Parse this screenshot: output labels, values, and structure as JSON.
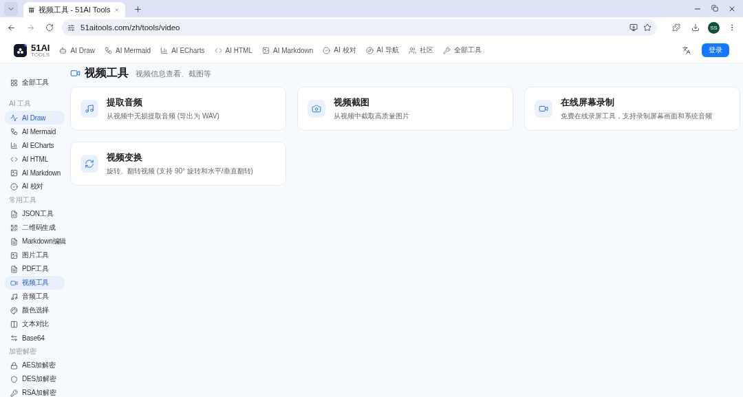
{
  "browser": {
    "tab_title": "视频工具 - 51AI Tools",
    "url": "51aitools.com/zh/tools/video",
    "profile": "SS"
  },
  "header": {
    "logo": "51AI",
    "logo_sub": "TOOLS",
    "nav": [
      {
        "label": "AI Draw"
      },
      {
        "label": "AI Mermaid"
      },
      {
        "label": "AI ECharts"
      },
      {
        "label": "AI HTML"
      },
      {
        "label": "AI Markdown"
      },
      {
        "label": "AI 校对"
      },
      {
        "label": "AI 导航"
      },
      {
        "label": "社区"
      },
      {
        "label": "全部工具"
      }
    ],
    "login": "登录"
  },
  "sidebar": {
    "top": "全部工具",
    "sections": [
      {
        "title": "AI 工具",
        "items": [
          {
            "label": "AI Draw",
            "selected": true
          },
          {
            "label": "AI Mermaid",
            "selected": false
          },
          {
            "label": "AI ECharts",
            "selected": false
          },
          {
            "label": "AI HTML",
            "selected": false
          },
          {
            "label": "AI Markdown",
            "selected": false
          },
          {
            "label": "AI 校对",
            "selected": false
          }
        ]
      },
      {
        "title": "常用工具",
        "items": [
          {
            "label": "JSON工具",
            "selected": false
          },
          {
            "label": "二维码生成",
            "selected": false
          },
          {
            "label": "Markdown编辑",
            "selected": false
          },
          {
            "label": "图片工具",
            "selected": false
          },
          {
            "label": "PDF工具",
            "selected": false
          },
          {
            "label": "视频工具",
            "selected": true
          },
          {
            "label": "音频工具",
            "selected": false
          },
          {
            "label": "颜色选择",
            "selected": false
          },
          {
            "label": "文本对比",
            "selected": false
          },
          {
            "label": "Base64",
            "selected": false
          }
        ]
      },
      {
        "title": "加密解密",
        "items": [
          {
            "label": "AES加解密",
            "selected": false
          },
          {
            "label": "DES加解密",
            "selected": false
          },
          {
            "label": "RSA加解密",
            "selected": false
          }
        ]
      }
    ]
  },
  "page": {
    "title": "视频工具",
    "subtitle": "视频信息查看、截图等",
    "tools": [
      {
        "title": "提取音频",
        "description": "从视频中无损提取音频 (导出为 WAV)"
      },
      {
        "title": "视频截图",
        "description": "从视频中截取高质量图片"
      },
      {
        "title": "在线屏幕录制",
        "description": "免费在线录屏工具，支持录制屏幕画面和系统音频"
      },
      {
        "title": "视频变换",
        "description": "旋转、翻转视频 (支持 90° 旋转和水平/垂直翻转)"
      }
    ]
  }
}
